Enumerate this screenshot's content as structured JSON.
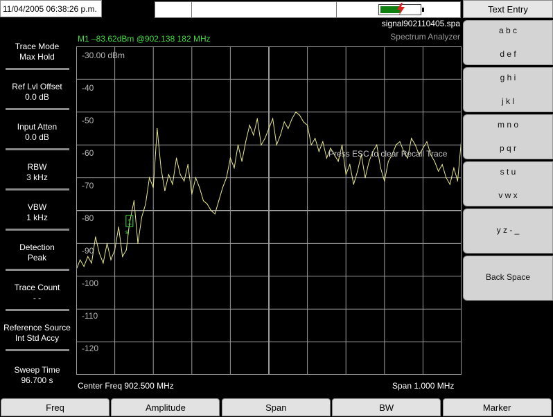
{
  "status": {
    "datetime": "11/04/2005 06:38:26 p.m.",
    "filename": "signal902110405.spa",
    "mode": "Spectrum Analyzer",
    "battery_level": 0.65,
    "colors": {
      "battery": "#108010",
      "charging_bolt": "#e02020"
    }
  },
  "marker": {
    "readout": "M1 –83.62dBm @902.138 182 MHz",
    "label": "1",
    "sub_label": "s",
    "color": "#3edc3e",
    "freq_mhz": 902.138182,
    "level_dbm": -83.62
  },
  "left_menu": [
    {
      "title": "Trace Mode",
      "value": "Max Hold"
    },
    {
      "title": "Ref Lvl Offset",
      "value": "0.0 dB"
    },
    {
      "title": "Input Atten",
      "value": "0.0 dB"
    },
    {
      "title": "RBW",
      "value": "3 kHz"
    },
    {
      "title": "VBW",
      "value": "1 kHz"
    },
    {
      "title": "Detection",
      "value": "Peak"
    },
    {
      "title": "Trace Count",
      "value": "- -"
    },
    {
      "title": "Reference Source",
      "value": "Int Std Accy"
    },
    {
      "title": "Sweep Time",
      "value": "96.700 s"
    }
  ],
  "plot": {
    "y_labels": [
      "-30.00 dBm",
      "-40",
      "-50",
      "-60",
      "-70",
      "-80",
      "-90",
      "-100",
      "-110",
      "-120"
    ],
    "message": "Press ESC to clear Recall Trace",
    "center_freq": "Center Freq 902.500 MHz",
    "span": "Span 1.000 MHz",
    "trace_color": "#e8e890",
    "grid_color": "#9a9a9a"
  },
  "chart_data": {
    "type": "line",
    "ylim": [
      -130,
      -30
    ],
    "xlim": [
      902.0,
      903.0
    ],
    "x_unit": "MHz",
    "y_unit": "dBm",
    "series": [
      {
        "x": [
          902.0,
          902.01,
          902.02,
          902.03,
          902.04,
          902.05,
          902.06,
          902.07,
          902.08,
          902.09,
          902.1,
          902.11,
          902.12,
          902.13,
          902.138,
          902.15,
          902.16,
          902.17,
          902.18,
          902.19,
          902.2,
          902.21,
          902.22,
          902.23,
          902.24,
          902.25,
          902.26,
          902.27,
          902.28,
          902.29,
          902.3,
          902.31,
          902.32,
          902.33,
          902.34,
          902.35,
          902.36,
          902.37,
          902.38,
          902.39,
          902.4,
          902.41,
          902.42,
          902.43,
          902.44,
          902.45,
          902.46,
          902.47,
          902.48,
          902.49,
          902.5,
          902.51,
          902.52,
          902.53,
          902.54,
          902.55,
          902.56,
          902.57,
          902.58,
          902.59,
          902.6,
          902.61,
          902.62,
          902.63,
          902.64,
          902.65,
          902.66,
          902.67,
          902.68,
          902.69,
          902.7,
          902.71,
          902.72,
          902.73,
          902.74,
          902.75,
          902.76,
          902.77,
          902.78,
          902.79,
          902.8,
          902.81,
          902.82,
          902.83,
          902.84,
          902.85,
          902.86,
          902.87,
          902.88,
          902.89,
          902.9,
          902.91,
          902.92,
          902.93,
          902.94,
          902.95,
          902.96,
          902.97,
          902.98,
          902.99,
          903.0
        ],
        "y": [
          -98,
          -95,
          -97,
          -94,
          -96,
          -88,
          -93,
          -96,
          -90,
          -95,
          -92,
          -85,
          -94,
          -92,
          -84,
          -77,
          -90,
          -82,
          -78,
          -70,
          -73,
          -55,
          -67,
          -74,
          -69,
          -72,
          -64,
          -69,
          -71,
          -66,
          -75,
          -70,
          -73,
          -77,
          -78,
          -80,
          -81,
          -77,
          -73,
          -70,
          -64,
          -67,
          -60,
          -65,
          -59,
          -54,
          -57,
          -52,
          -60,
          -58,
          -55,
          -52,
          -60,
          -57,
          -53,
          -55,
          -52,
          -50,
          -51,
          -53,
          -54,
          -60,
          -58,
          -62,
          -59,
          -64,
          -61,
          -63,
          -65,
          -60,
          -69,
          -66,
          -72,
          -68,
          -63,
          -70,
          -65,
          -62,
          -60,
          -67,
          -71,
          -65,
          -63,
          -60,
          -59,
          -62,
          -64,
          -58,
          -60,
          -63,
          -61,
          -59,
          -63,
          -65,
          -68,
          -66,
          -70,
          -72,
          -67,
          -71,
          -58
        ]
      }
    ]
  },
  "right_menu": {
    "title": "Text Entry",
    "keys": [
      {
        "line1": "a b c",
        "line2": "d e f"
      },
      {
        "line1": "g h i",
        "line2": "j k l"
      },
      {
        "line1": "m n o",
        "line2": "p q r"
      },
      {
        "line1": "s t u",
        "line2": "v w x"
      },
      {
        "line1": "y z - _",
        "line2": ""
      },
      {
        "line1": "Back Space",
        "line2": ""
      }
    ]
  },
  "bottom_menu": [
    "Freq",
    "Amplitude",
    "Span",
    "BW",
    "Marker"
  ]
}
